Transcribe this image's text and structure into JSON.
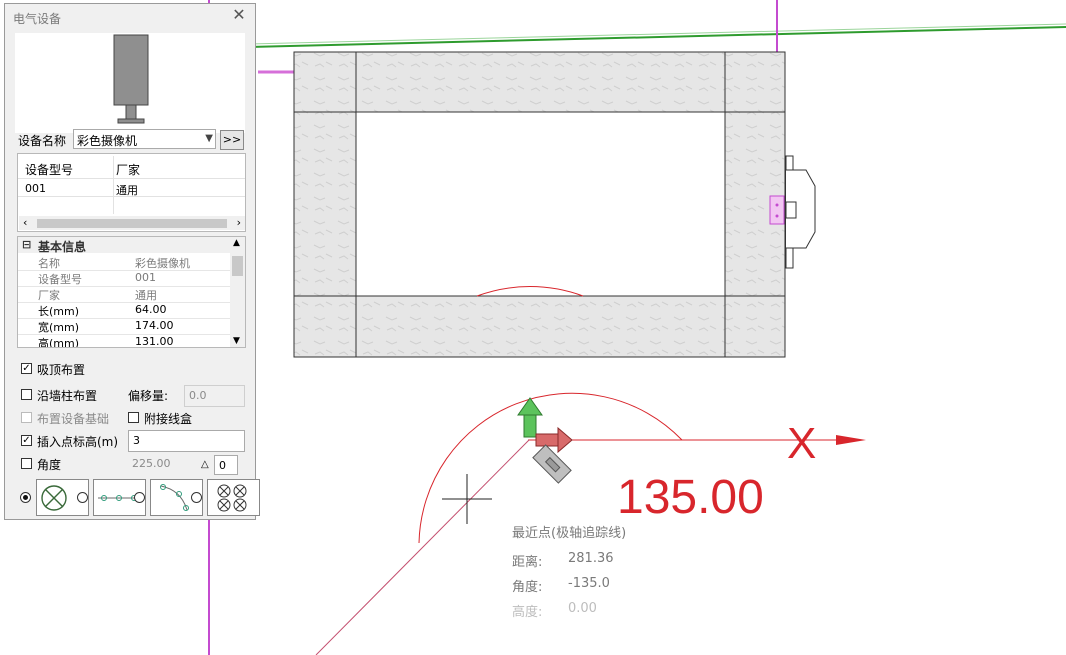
{
  "colors": {
    "accent_red": "#d8262c",
    "pipe_pink": "#c44bd0",
    "green_line": "#2e9b2e"
  },
  "panel": {
    "title": "电气设备",
    "close_icon": "close-icon",
    "device_name_label": "设备名称",
    "device_name_value": "彩色摄像机",
    "more_button": ">>",
    "grid": {
      "headers": [
        "设备型号",
        "厂家"
      ],
      "rows": [
        [
          "001",
          "通用"
        ]
      ]
    },
    "props": {
      "group": "基本信息",
      "rows": [
        {
          "k": "名称",
          "v": "彩色摄像机"
        },
        {
          "k": "设备型号",
          "v": "001"
        },
        {
          "k": "厂家",
          "v": "通用"
        },
        {
          "k": "长(mm)",
          "v": "64.00"
        },
        {
          "k": "宽(mm)",
          "v": "174.00"
        },
        {
          "k": "高(mm)",
          "v": "131.00"
        }
      ]
    },
    "opt_ceiling": "吸顶布置",
    "opt_wall": "沿墙柱布置",
    "offset_label": "偏移量:",
    "offset_value": "0.0",
    "opt_base": "布置设备基础",
    "opt_junction": "附接线盒",
    "opt_insert_height": "插入点标高(m)",
    "insert_height_value": "3",
    "opt_angle": "角度",
    "angle_value": "225.00",
    "angle_step": "0"
  },
  "cad": {
    "angle_readout": "135.00",
    "snap_title": "最近点(极轴追踪线)",
    "dist_label": "距离:",
    "dist_value": "281.36",
    "angle_label": "角度:",
    "angle_value": "-135.0",
    "height_label": "高度:",
    "height_value": "0.00"
  }
}
